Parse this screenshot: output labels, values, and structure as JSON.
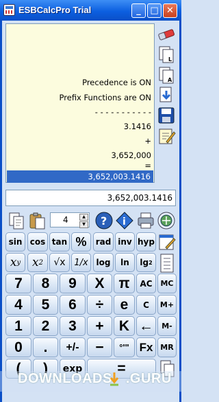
{
  "window": {
    "title": "ESBCalcPro Trial",
    "minimize": "_",
    "maximize": "□",
    "close": "✕"
  },
  "tape": {
    "lines": [
      "Precedence is ON",
      "Prefix Functions are ON",
      "- - - - - - - - - - -",
      "3.1416",
      "+",
      "3,652,000",
      "="
    ],
    "result": "3,652,003.1416"
  },
  "display": {
    "value": "3,652,003.1416"
  },
  "toolbar": {
    "decimals": "4"
  },
  "sci_row": [
    "sin",
    "cos",
    "tan",
    "%",
    "rad",
    "inv",
    "hyp"
  ],
  "fn_row": {
    "pow_xy": "x",
    "pow_xy_sup": "y",
    "square": "x",
    "square_sup": "2",
    "sqrt": "√x",
    "recip": "1/x",
    "log": "log",
    "ln": "ln",
    "lg2": "lg",
    "lg2_sub": "2"
  },
  "keypad": {
    "row1": [
      "7",
      "8",
      "9",
      "X",
      "π",
      "AC",
      "MC"
    ],
    "row2": [
      "4",
      "5",
      "6",
      "÷",
      "e",
      "C",
      "M+"
    ],
    "row3": [
      "1",
      "2",
      "3",
      "+",
      "K",
      "←",
      "M-"
    ],
    "row4": [
      "0",
      ".",
      "+/-",
      "−",
      "°'\"",
      "Fx",
      "MR"
    ],
    "row5": [
      "(",
      ")",
      "exp",
      "="
    ]
  },
  "watermark": {
    "text": "DOWNLOADS",
    "suffix": ".GURU"
  },
  "colors": {
    "titlebar": "#0c5fe0",
    "tape_bg": "#fcfcde",
    "highlight": "#3169c6",
    "background": "#d4e2f4"
  }
}
